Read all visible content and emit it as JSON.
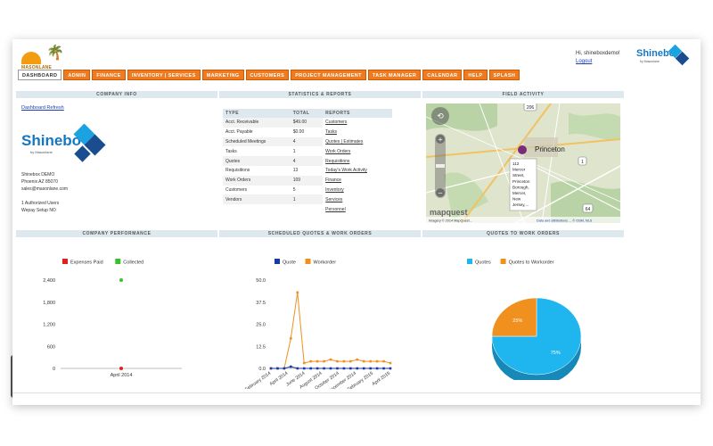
{
  "header": {
    "logo_left_text": "MASONLANE",
    "greeting": "Hi, shineboxdemo!",
    "logout": "Logout",
    "logo_word": "Shinebo",
    "logo_sub": "by Masonlane"
  },
  "nav": {
    "tabs": [
      {
        "label": "DASHBOARD",
        "active": true
      },
      {
        "label": "ADMIN"
      },
      {
        "label": "FINANCE"
      },
      {
        "label": "INVENTORY | SERVICES"
      },
      {
        "label": "MARKETING"
      },
      {
        "label": "CUSTOMERS"
      },
      {
        "label": "PROJECT MANAGEMENT"
      },
      {
        "label": "TASK MANAGER"
      },
      {
        "label": "CALENDAR"
      },
      {
        "label": "HELP"
      },
      {
        "label": "SPLASH"
      }
    ]
  },
  "panels": {
    "company_info": "COMPANY INFO",
    "stats_reports": "STATISTICS & REPORTS",
    "field_activity": "FIELD ACTIVITY",
    "company_performance": "COMPANY PERFORMANCE",
    "scheduled_quotes": "SCHEDULED QUOTES & WORK ORDERS",
    "quotes_to_work_orders": "QUOTES TO WORK ORDERS"
  },
  "company": {
    "refresh_link": "Dashboard Refresh",
    "logo_word": "Shinebo",
    "logo_sub": "by Masonlane",
    "lines": [
      "Shinebox DEMO",
      "Phoenix AZ 85070",
      "sales@masonlane.com",
      "",
      "1 Authorized Users",
      "Wepay Setup NO"
    ]
  },
  "stats": {
    "headers": [
      "TYPE",
      "TOTAL",
      "REPORTS"
    ],
    "rows": [
      {
        "type": "Acct. Receivable",
        "total": "$49.00",
        "report": "Customers"
      },
      {
        "type": "Acct. Payable",
        "total": "$0.00",
        "report": "Tasks"
      },
      {
        "type": "Scheduled Meetings",
        "total": "4",
        "report": "Quotes | Estimates"
      },
      {
        "type": "Tasks",
        "total": "1",
        "report": "Work Orders"
      },
      {
        "type": "Quotes",
        "total": "4",
        "report": "Requisitions"
      },
      {
        "type": "Requisitions",
        "total": "13",
        "report": "Today's Work Activity"
      },
      {
        "type": "Work Orders",
        "total": "109",
        "report": "Finance"
      },
      {
        "type": "Customers",
        "total": "5",
        "report": "Inventory"
      },
      {
        "type": "Vendors",
        "total": "1",
        "report": "Services"
      },
      {
        "type": "",
        "total": "",
        "report": "Personnel"
      }
    ]
  },
  "map": {
    "city": "Princeton",
    "badge_206": "206",
    "badge_1": "1",
    "badge_64": "64",
    "popup_lines": [
      "112",
      "Mercer",
      "Street,",
      "Princeton",
      "Borough,",
      "Mercer,",
      "New",
      "Jersey,..."
    ],
    "brand": "mapquest",
    "footer_left": "Imagery © 2014 MapQuest...",
    "footer_right": "Data and attributions ... © OSM, NLS"
  },
  "chart_data": [
    {
      "type": "scatter",
      "legend": [
        "Expenses Paid",
        "Collected"
      ],
      "series": [
        {
          "name": "Expenses Paid",
          "color": "#e02020",
          "points": [
            {
              "x": "April 2014",
              "y": 0
            }
          ]
        },
        {
          "name": "Collected",
          "color": "#3cbf2c",
          "points": [
            {
              "x": "April 2014",
              "y": 2400
            }
          ]
        }
      ],
      "yticks": [
        "2,400",
        "1,800",
        "1,200",
        "600",
        "0"
      ],
      "ytick_values": [
        2400,
        1800,
        1200,
        600,
        0
      ],
      "categories": [
        "April 2014"
      ],
      "ylim": [
        0,
        2400
      ]
    },
    {
      "type": "line",
      "legend": [
        "Quote",
        "Workorder"
      ],
      "categories": [
        "February 2014",
        "April 2014",
        "June 2014",
        "August 2014",
        "October 2014",
        "December 2014",
        "February 2015",
        "April 2015"
      ],
      "x_count": 19,
      "series": [
        {
          "name": "Quote",
          "color": "#1a3a9e",
          "values": [
            0,
            0,
            0,
            1,
            0,
            0,
            0,
            0,
            0,
            0,
            0,
            0,
            0,
            0,
            0,
            0,
            0,
            0,
            0
          ]
        },
        {
          "name": "Workorder",
          "color": "#f0901e",
          "values": [
            0,
            0,
            0,
            17,
            43,
            3,
            4,
            4,
            4,
            5,
            4,
            4,
            4,
            5,
            4,
            4,
            4,
            4,
            3
          ]
        }
      ],
      "yticks": [
        "50.0",
        "37.5",
        "25.0",
        "12.5",
        "0.0"
      ],
      "ytick_values": [
        50,
        37.5,
        25,
        12.5,
        0
      ],
      "ylim": [
        0,
        50
      ]
    },
    {
      "type": "pie",
      "legend": [
        "Quotes",
        "Quotes to Workorder"
      ],
      "slices": [
        {
          "label": "Quotes",
          "value": 75,
          "text": "75%",
          "color": "#1fb6ef"
        },
        {
          "label": "Quotes to Workorder",
          "value": 25,
          "text": "25%",
          "color": "#f0901e"
        }
      ]
    }
  ]
}
